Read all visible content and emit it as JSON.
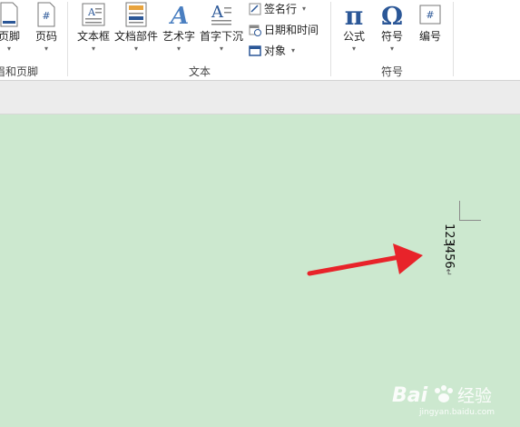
{
  "ribbon": {
    "header_footer": {
      "footer_label": "页脚",
      "page_number_label": "页码",
      "group_label": "眉和页脚"
    },
    "text_group": {
      "textbox_label": "文本框",
      "quick_parts_label": "文档部件",
      "wordart_label": "艺术字",
      "dropcap_label": "首字下沉",
      "signature_line_label": "签名行",
      "date_time_label": "日期和时间",
      "object_label": "对象",
      "group_label": "文本"
    },
    "symbols_group": {
      "equation_label": "公式",
      "symbol_label": "符号",
      "number_label": "编号",
      "group_label": "符号"
    }
  },
  "document": {
    "vertical_text": "123456",
    "paragraph_mark": "↵"
  },
  "annotation": {
    "arrow_color": "#e8232a"
  },
  "watermark": {
    "brand_text": "Bai",
    "brand_suffix": "经验",
    "url": "jingyan.baidu.com"
  },
  "colors": {
    "page_background": "#cce8cf",
    "ribbon_background": "#ffffff",
    "icon_blue": "#2b5797"
  }
}
